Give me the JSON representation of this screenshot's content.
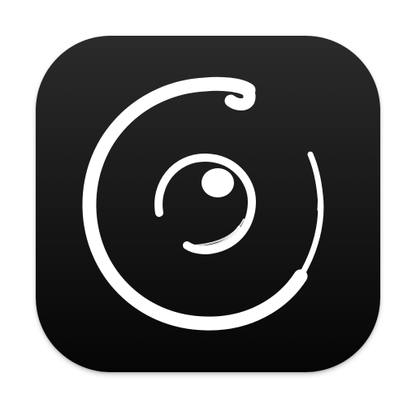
{
  "app_icon": {
    "icon_name": "camera-lens-brush-stroke-icon",
    "colors": {
      "background_top": "#2b2b2b",
      "background_bottom": "#050505",
      "stroke": "#ffffff"
    }
  }
}
